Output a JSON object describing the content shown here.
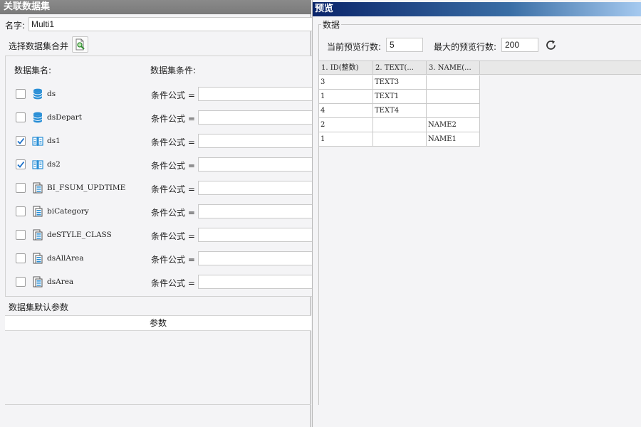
{
  "left_panel": {
    "title": "关联数据集",
    "name_label": "名字:",
    "name_value": "Multi1",
    "merge_label": "选择数据集合并",
    "col_name_header": "数据集名:",
    "col_cond_header": "数据集条件:",
    "cond_label": "条件公式 =",
    "datasets": [
      {
        "name": "ds",
        "checked": false,
        "icon": "database-icon"
      },
      {
        "name": "dsDepart",
        "checked": false,
        "icon": "database-icon"
      },
      {
        "name": "ds1",
        "checked": true,
        "icon": "book-icon"
      },
      {
        "name": "ds2",
        "checked": true,
        "icon": "book-icon"
      },
      {
        "name": "BI_FSUM_UPDTIME",
        "checked": false,
        "icon": "server-dataset-icon"
      },
      {
        "name": "biCategory",
        "checked": false,
        "icon": "server-dataset-icon"
      },
      {
        "name": "deSTYLE_CLASS",
        "checked": false,
        "icon": "server-dataset-icon"
      },
      {
        "name": "dsAllArea",
        "checked": false,
        "icon": "server-dataset-icon"
      },
      {
        "name": "dsArea",
        "checked": false,
        "icon": "server-dataset-icon"
      }
    ],
    "param_title": "数据集默认参数",
    "param_header": "参数"
  },
  "right_panel": {
    "title": "预览",
    "group_legend": "数据",
    "current_rows_label": "当前预览行数:",
    "current_rows_value": "5",
    "max_rows_label": "最大的预览行数:",
    "max_rows_value": "200",
    "columns": [
      "1. ID(整数)",
      "2. TEXT(...",
      "3. NAME(..."
    ],
    "rows": [
      [
        "3",
        "TEXT3",
        ""
      ],
      [
        "1",
        "TEXT1",
        ""
      ],
      [
        "4",
        "TEXT4",
        ""
      ],
      [
        "2",
        "",
        "NAME2"
      ],
      [
        "1",
        "",
        "NAME1"
      ]
    ]
  },
  "colors": {
    "left_title_bg": "#808080",
    "right_title_bg": "#0a246a",
    "db_icon": "#2a8fd6",
    "check": "#1a6fc9"
  }
}
